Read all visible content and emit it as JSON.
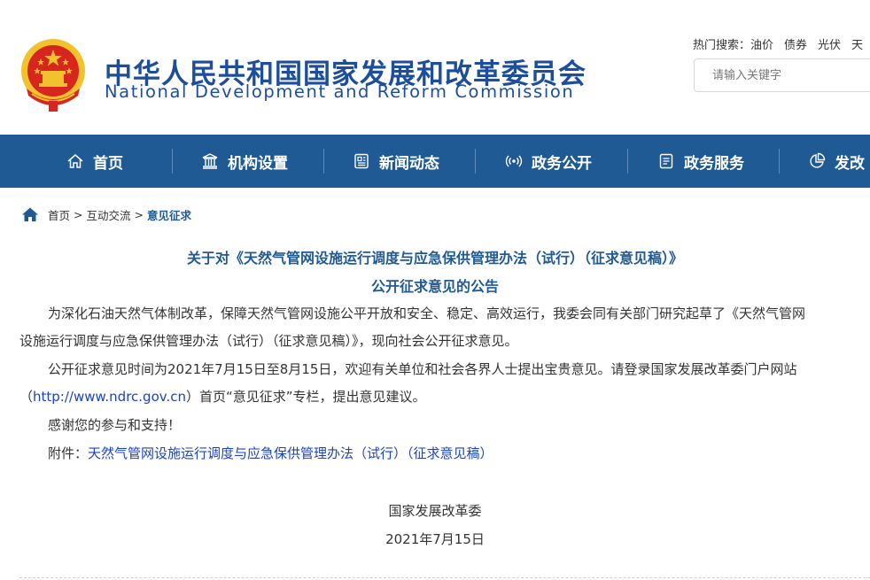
{
  "header": {
    "title_cn": "中华人民共和国国家发展和改革委员会",
    "title_en": "National Development and Reform Commission",
    "hot_label": "热门搜索：",
    "hot_terms": [
      "油价",
      "债券",
      "光伏",
      "天"
    ],
    "search_placeholder": "请输入关键字"
  },
  "nav": {
    "items": [
      {
        "label": "首页",
        "icon": "home-icon"
      },
      {
        "label": "机构设置",
        "icon": "building-icon"
      },
      {
        "label": "新闻动态",
        "icon": "news-icon"
      },
      {
        "label": "政务公开",
        "icon": "broadcast-icon"
      },
      {
        "label": "政务服务",
        "icon": "document-icon"
      },
      {
        "label": "发改",
        "icon": "pie-chart-icon"
      }
    ]
  },
  "breadcrumb": {
    "home": "首页",
    "sep": ">",
    "level1": "互动交流",
    "current": "意见征求"
  },
  "article": {
    "title_line1": "关于对《天然气管网设施运行调度与应急保供管理办法（试行）（征求意见稿）》",
    "title_line2": "公开征求意见的公告",
    "p1_line1": "为深化石油天然气体制改革，保障天然气管网设施公平开放和安全、稳定、高效运行，我委会同有关部门研究起草了《天然气管网",
    "p1_line2": "设施运行调度与应急保供管理办法（试行）（征求意见稿）》，现向社会公开征求意见。",
    "p2_line1": "公开征求意见时间为2021年7月15日至8月15日，欢迎有关单位和社会各界人士提出宝贵意见。请登录国家发展改革委门户网站",
    "p2_open": "（",
    "p2_url": "http://www.ndrc.gov.cn",
    "p2_rest": "）首页“意见征求”专栏，提出意见建议。",
    "p3": "感谢您的参与和支持！",
    "attach_label": "附件：",
    "attach_link": "天然气管网设施运行调度与应急保供管理办法（试行）（征求意见稿）",
    "signature": "国家发展改革委",
    "date": "2021年7月15日"
  },
  "colors": {
    "nav_bg": "#1f5a95",
    "title_blue": "#1d4e9c",
    "link_blue": "#1a44c2",
    "emblem_red": "#d7261e",
    "emblem_gold": "#f2c12e"
  }
}
